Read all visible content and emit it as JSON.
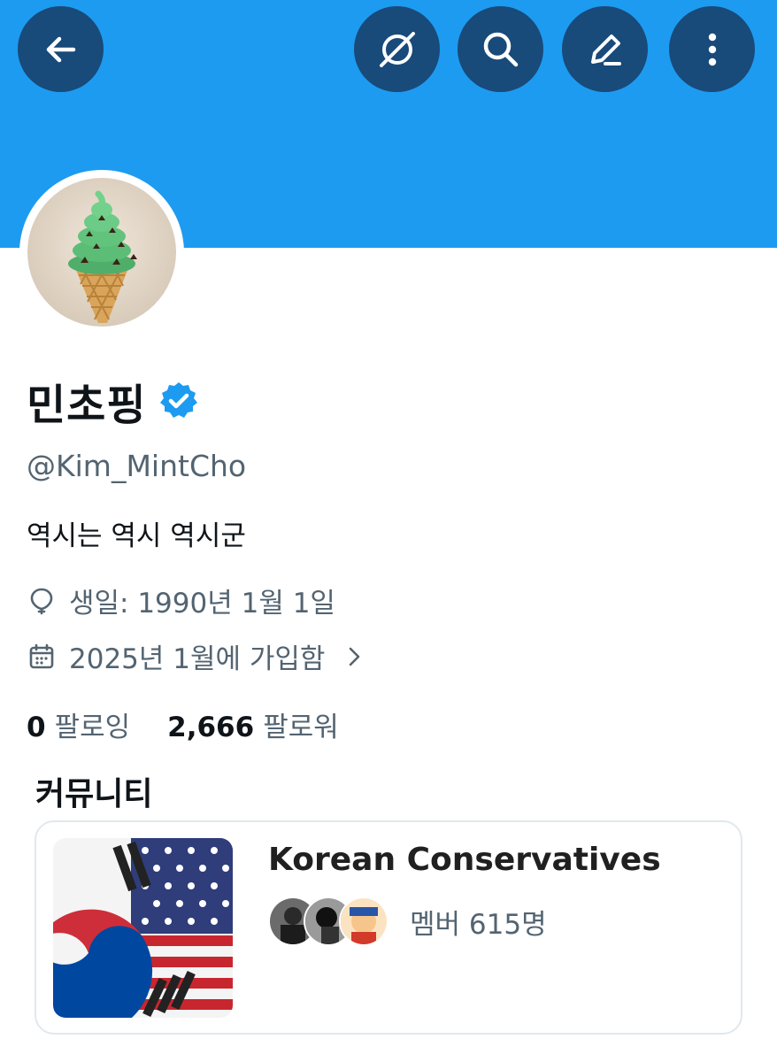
{
  "colors": {
    "banner": "#1d9bf0",
    "button_bg": "#184a7a",
    "verified": "#1d9bf0",
    "text_primary": "#0f1419",
    "text_secondary": "#536471"
  },
  "header": {
    "back_icon": "arrow-left-icon",
    "buttons": [
      "translate-icon",
      "search-icon",
      "edit-icon",
      "more-vertical-icon"
    ]
  },
  "profile": {
    "avatar_icon": "mint-chocolate-ice-cream-avatar",
    "name": "민초핑",
    "verified_icon": "verified-badge-icon",
    "handle": "@Kim_MintCho",
    "bio": "역시는 역시 역시군",
    "birthday": "생일: 1990년 1월 1일",
    "joined": "2025년 1월에 가입함",
    "following_count": "0",
    "following_label": "팔로잉",
    "followers_count": "2,666",
    "followers_label": "팔로워"
  },
  "community": {
    "heading": "커뮤니티",
    "name": "Korean Conservatives",
    "members": "멤버 615명",
    "thumb_icon": "korea-usa-flag-image"
  }
}
